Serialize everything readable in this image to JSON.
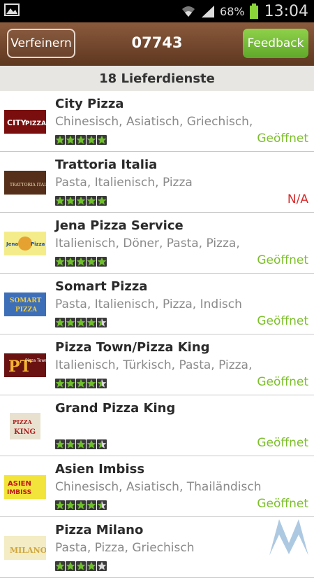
{
  "statusbar": {
    "battery": "68%",
    "time": "13:04"
  },
  "header": {
    "refine_label": "Verfeinern",
    "title": "07743",
    "feedback_label": "Feedback"
  },
  "subheader": "18 Lieferdienste",
  "restaurants": [
    {
      "name": "City Pizza",
      "cuisines": "Chinesisch, Asiatisch, Griechisch,",
      "rating": 5,
      "status": "Geöffnet",
      "logo_text": "CITY PIZZA"
    },
    {
      "name": "Trattoria Italia",
      "cuisines": "Pasta, Italienisch, Pizza",
      "rating": 5,
      "status": "N/A",
      "logo_text": "TRATTORIA ITALIA"
    },
    {
      "name": "Jena Pizza Service",
      "cuisines": "Italienisch, Döner, Pasta, Pizza,",
      "rating": 5,
      "status": "Geöffnet",
      "logo_text": "Jena Pizza"
    },
    {
      "name": "Somart Pizza",
      "cuisines": "Pasta, Italienisch, Pizza, Indisch",
      "rating": 4.5,
      "status": "Geöffnet",
      "logo_text": "SOMART PIZZA"
    },
    {
      "name": "Pizza Town/Pizza King",
      "cuisines": "Italienisch, Türkisch, Pasta, Pizza,",
      "rating": 4.5,
      "status": "Geöffnet",
      "logo_text": "Pizza Town"
    },
    {
      "name": "Grand Pizza King",
      "cuisines": "",
      "rating": 4.5,
      "status": "Geöffnet",
      "logo_text": "PIZZA KING"
    },
    {
      "name": "Asien Imbiss",
      "cuisines": "Chinesisch, Asiatisch, Thailändisch",
      "rating": 4.5,
      "status": "Geöffnet",
      "logo_text": "ASIEN IMBISS"
    },
    {
      "name": "Pizza Milano",
      "cuisines": "Pasta, Pizza, Griechisch",
      "rating": 4,
      "status": "",
      "logo_text": "MILANO"
    }
  ],
  "colors": {
    "open": "#7cbf2a",
    "na": "#d82b2b",
    "header": "#6e442a",
    "feedback": "#6fb82f"
  }
}
